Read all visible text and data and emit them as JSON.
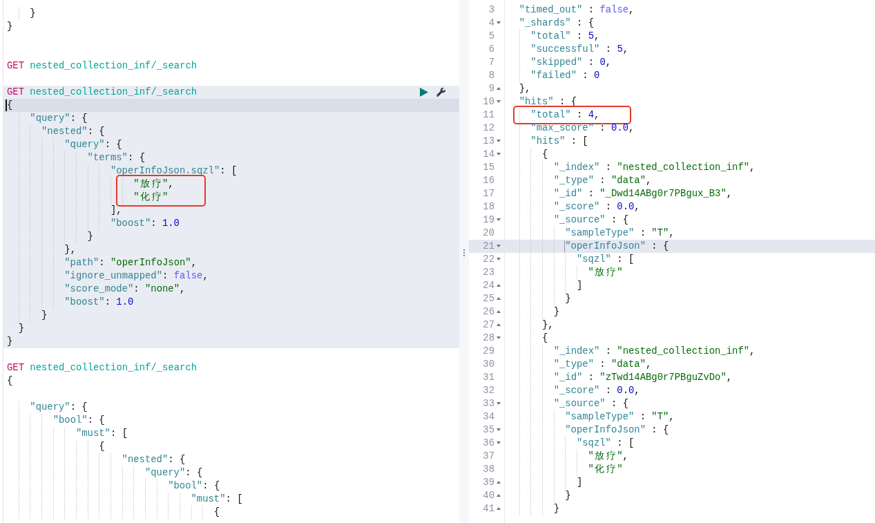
{
  "request_panel": {
    "focused": true,
    "blocks": [
      {
        "kind": "fragment",
        "lines": [
          {
            "kind": "code",
            "text": "    }",
            "active": false
          },
          {
            "kind": "code",
            "text": "}",
            "active": false
          }
        ]
      },
      {
        "kind": "blank"
      },
      {
        "kind": "blank"
      },
      {
        "kind": "request",
        "method": "GET",
        "url": "nested_collection_inf/_search",
        "selected": false
      },
      {
        "kind": "blank"
      },
      {
        "kind": "request",
        "method": "GET",
        "url": "nested_collection_inf/_search",
        "selected": true,
        "lines": [
          {
            "kind": "code",
            "text": "{",
            "active": true
          },
          {
            "kind": "code",
            "text": "    \"query\": {",
            "active": false
          },
          {
            "kind": "code",
            "text": "      \"nested\": {",
            "active": false
          },
          {
            "kind": "code",
            "text": "          \"query\": {",
            "active": false
          },
          {
            "kind": "code",
            "text": "              \"terms\": {",
            "active": false
          },
          {
            "kind": "code",
            "text": "                  \"operInfoJson.sqzl\": [",
            "active": false
          },
          {
            "kind": "annotation",
            "lines": [
              {
                "kind": "code",
                "text": "                      \"放疗\",",
                "active": false
              },
              {
                "kind": "code",
                "text": "                      \"化疗\"",
                "active": false
              }
            ]
          },
          {
            "kind": "code",
            "text": "                  ],",
            "active": false
          },
          {
            "kind": "code",
            "text": "                  \"boost\": 1.0",
            "active": false
          },
          {
            "kind": "code",
            "text": "              }",
            "active": false
          },
          {
            "kind": "code",
            "text": "          },",
            "active": false
          },
          {
            "kind": "code",
            "text": "          \"path\": \"operInfoJson\",",
            "active": false
          },
          {
            "kind": "code",
            "text": "          \"ignore_unmapped\": false,",
            "active": false
          },
          {
            "kind": "code",
            "text": "          \"score_mode\": \"none\",",
            "active": false
          },
          {
            "kind": "code",
            "text": "          \"boost\": 1.0",
            "active": false
          },
          {
            "kind": "code",
            "text": "      }",
            "active": false
          },
          {
            "kind": "code",
            "text": "  }",
            "active": false
          },
          {
            "kind": "code",
            "text": "}",
            "active": false
          }
        ]
      },
      {
        "kind": "blank"
      },
      {
        "kind": "request",
        "method": "GET",
        "url": "nested_collection_inf/_search",
        "selected": false,
        "lines": [
          {
            "kind": "code",
            "text": "{",
            "active": false
          },
          {
            "kind": "blank"
          },
          {
            "kind": "code",
            "text": "    \"query\": {",
            "active": false
          },
          {
            "kind": "code",
            "text": "        \"bool\": {",
            "active": false
          },
          {
            "kind": "code",
            "text": "            \"must\": [",
            "active": false
          },
          {
            "kind": "code",
            "text": "                {",
            "active": false
          },
          {
            "kind": "code",
            "text": "                    \"nested\": {",
            "active": false
          },
          {
            "kind": "code",
            "text": "                        \"query\": {",
            "active": false
          },
          {
            "kind": "code",
            "text": "                            \"bool\": {",
            "active": false
          },
          {
            "kind": "code",
            "text": "                                \"must\": [",
            "active": false
          },
          {
            "kind": "code",
            "text": "                                    {",
            "active": false
          }
        ]
      }
    ]
  },
  "response_panel": {
    "focused": false,
    "lines": [
      {
        "kind": "code",
        "number": "3",
        "text": "  \"timed_out\" : false,",
        "active": false
      },
      {
        "kind": "code",
        "number": "4",
        "fold_widget": {
          "kind": "start"
        },
        "text": "  \"_shards\" : {",
        "active": false
      },
      {
        "kind": "code",
        "number": "5",
        "text": "    \"total\" : 5,",
        "active": false
      },
      {
        "kind": "code",
        "number": "6",
        "text": "    \"successful\" : 5,",
        "active": false
      },
      {
        "kind": "code",
        "number": "7",
        "text": "    \"skipped\" : 0,",
        "active": false
      },
      {
        "kind": "code",
        "number": "8",
        "text": "    \"failed\" : 0",
        "active": false
      },
      {
        "kind": "code",
        "number": "9",
        "fold_widget": {
          "kind": "end"
        },
        "text": "  },",
        "active": false
      },
      {
        "kind": "code",
        "number": "10",
        "fold_widget": {
          "kind": "start"
        },
        "text": "  \"hits\" : {",
        "active": false
      },
      {
        "kind": "annotation",
        "lines": [
          {
            "kind": "code",
            "number": "11",
            "text": "    \"total\" : 4,",
            "active": false
          }
        ]
      },
      {
        "kind": "code",
        "number": "12",
        "text": "    \"max_score\" : 0.0,",
        "active": false
      },
      {
        "kind": "code",
        "number": "13",
        "fold_widget": {
          "kind": "start"
        },
        "text": "    \"hits\" : [",
        "active": false
      },
      {
        "kind": "code",
        "number": "14",
        "fold_widget": {
          "kind": "start"
        },
        "text": "      {",
        "active": false
      },
      {
        "kind": "code",
        "number": "15",
        "text": "        \"_index\" : \"nested_collection_inf\",",
        "active": false
      },
      {
        "kind": "code",
        "number": "16",
        "text": "        \"_type\" : \"data\",",
        "active": false
      },
      {
        "kind": "code",
        "number": "17",
        "text": "        \"_id\" : \"_Dwd14ABg0r7PBgux_B3\",",
        "active": false
      },
      {
        "kind": "code",
        "number": "18",
        "text": "        \"_score\" : 0.0,",
        "active": false
      },
      {
        "kind": "code",
        "number": "19",
        "fold_widget": {
          "kind": "start"
        },
        "text": "        \"_source\" : {",
        "active": false
      },
      {
        "kind": "code",
        "number": "20",
        "text": "          \"sampleType\" : \"T\",",
        "active": false
      },
      {
        "kind": "code",
        "number": "21",
        "fold_widget": {
          "kind": "start"
        },
        "text": "          \"operInfoJson\" : {",
        "active": true
      },
      {
        "kind": "code",
        "number": "22",
        "fold_widget": {
          "kind": "start"
        },
        "text": "            \"sqzl\" : [",
        "active": false
      },
      {
        "kind": "code",
        "number": "23",
        "text": "              \"放疗\"",
        "active": false
      },
      {
        "kind": "code",
        "number": "24",
        "fold_widget": {
          "kind": "end"
        },
        "text": "            ]",
        "active": false
      },
      {
        "kind": "code",
        "number": "25",
        "fold_widget": {
          "kind": "end"
        },
        "text": "          }",
        "active": false
      },
      {
        "kind": "code",
        "number": "26",
        "fold_widget": {
          "kind": "end"
        },
        "text": "        }",
        "active": false
      },
      {
        "kind": "code",
        "number": "27",
        "fold_widget": {
          "kind": "end"
        },
        "text": "      },",
        "active": false
      },
      {
        "kind": "code",
        "number": "28",
        "fold_widget": {
          "kind": "start"
        },
        "text": "      {",
        "active": false
      },
      {
        "kind": "code",
        "number": "29",
        "text": "        \"_index\" : \"nested_collection_inf\",",
        "active": false
      },
      {
        "kind": "code",
        "number": "30",
        "text": "        \"_type\" : \"data\",",
        "active": false
      },
      {
        "kind": "code",
        "number": "31",
        "text": "        \"_id\" : \"zTwd14ABg0r7PBguZvDo\",",
        "active": false
      },
      {
        "kind": "code",
        "number": "32",
        "text": "        \"_score\" : 0.0,",
        "active": false
      },
      {
        "kind": "code",
        "number": "33",
        "fold_widget": {
          "kind": "start"
        },
        "text": "        \"_source\" : {",
        "active": false
      },
      {
        "kind": "code",
        "number": "34",
        "text": "          \"sampleType\" : \"T\",",
        "active": false
      },
      {
        "kind": "code",
        "number": "35",
        "fold_widget": {
          "kind": "start"
        },
        "text": "          \"operInfoJson\" : {",
        "active": false
      },
      {
        "kind": "code",
        "number": "36",
        "fold_widget": {
          "kind": "start"
        },
        "text": "            \"sqzl\" : [",
        "active": false
      },
      {
        "kind": "code",
        "number": "37",
        "text": "              \"放疗\",",
        "active": false
      },
      {
        "kind": "code",
        "number": "38",
        "text": "              \"化疗\"",
        "active": false
      },
      {
        "kind": "code",
        "number": "39",
        "fold_widget": {
          "kind": "end"
        },
        "text": "            ]",
        "active": false
      },
      {
        "kind": "code",
        "number": "40",
        "fold_widget": {
          "kind": "end"
        },
        "text": "          }",
        "active": false
      },
      {
        "kind": "code",
        "number": "41",
        "fold_widget": {
          "kind": "end"
        },
        "text": "        }",
        "active": false
      }
    ]
  }
}
